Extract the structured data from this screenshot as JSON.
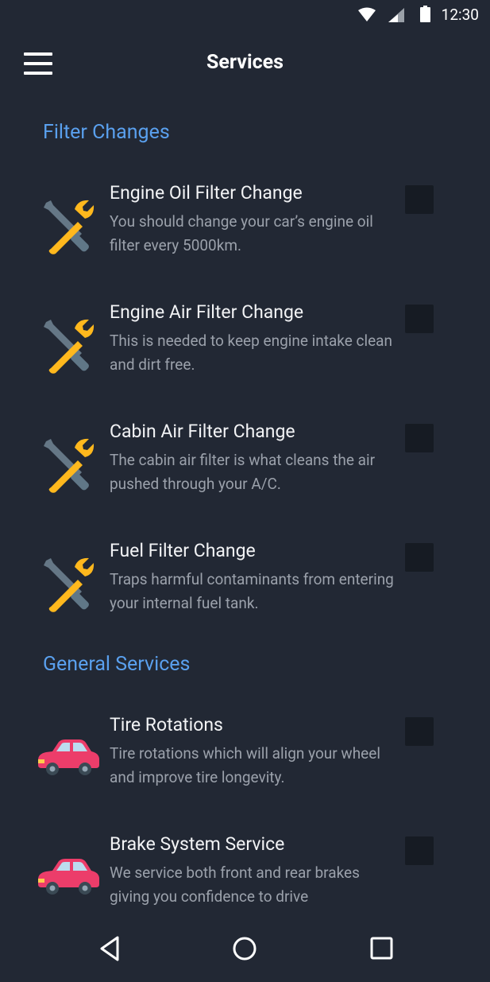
{
  "status_bar": {
    "time": "12:30"
  },
  "toolbar": {
    "title": "Services"
  },
  "sections": {
    "filter": {
      "header": "Filter Changes",
      "items": [
        {
          "title": "Engine Oil Filter Change",
          "description": "You should change your car’s engine oil filter every 5000km.",
          "icon": "wrench-screwdriver-icon",
          "checked": false
        },
        {
          "title": "Engine Air Filter Change",
          "description": "This is needed to keep engine intake clean and dirt free.",
          "icon": "wrench-screwdriver-icon",
          "checked": false
        },
        {
          "title": "Cabin Air Filter Change",
          "description": "The cabin air filter is what cleans the air pushed through your A/C.",
          "icon": "wrench-screwdriver-icon",
          "checked": false
        },
        {
          "title": "Fuel Filter Change",
          "description": "Traps harmful contaminants from entering your internal fuel tank.",
          "icon": "wrench-screwdriver-icon",
          "checked": false
        }
      ]
    },
    "general": {
      "header": "General Services",
      "items": [
        {
          "title": "Tire Rotations",
          "description": "Tire rotations which will align your wheel and improve tire longevity.",
          "icon": "car-icon",
          "checked": false
        },
        {
          "title": "Brake System Service",
          "description": "We service both front and rear brakes giving you confidence to drive",
          "icon": "car-icon",
          "checked": false
        }
      ]
    }
  },
  "colors": {
    "background": "#222834",
    "accent": "#5aa0ee",
    "checkbox": "#161b23"
  },
  "nav_bar": {
    "back_icon": "triangle-back-icon",
    "home_icon": "circle-home-icon",
    "recents_icon": "square-recents-icon"
  }
}
